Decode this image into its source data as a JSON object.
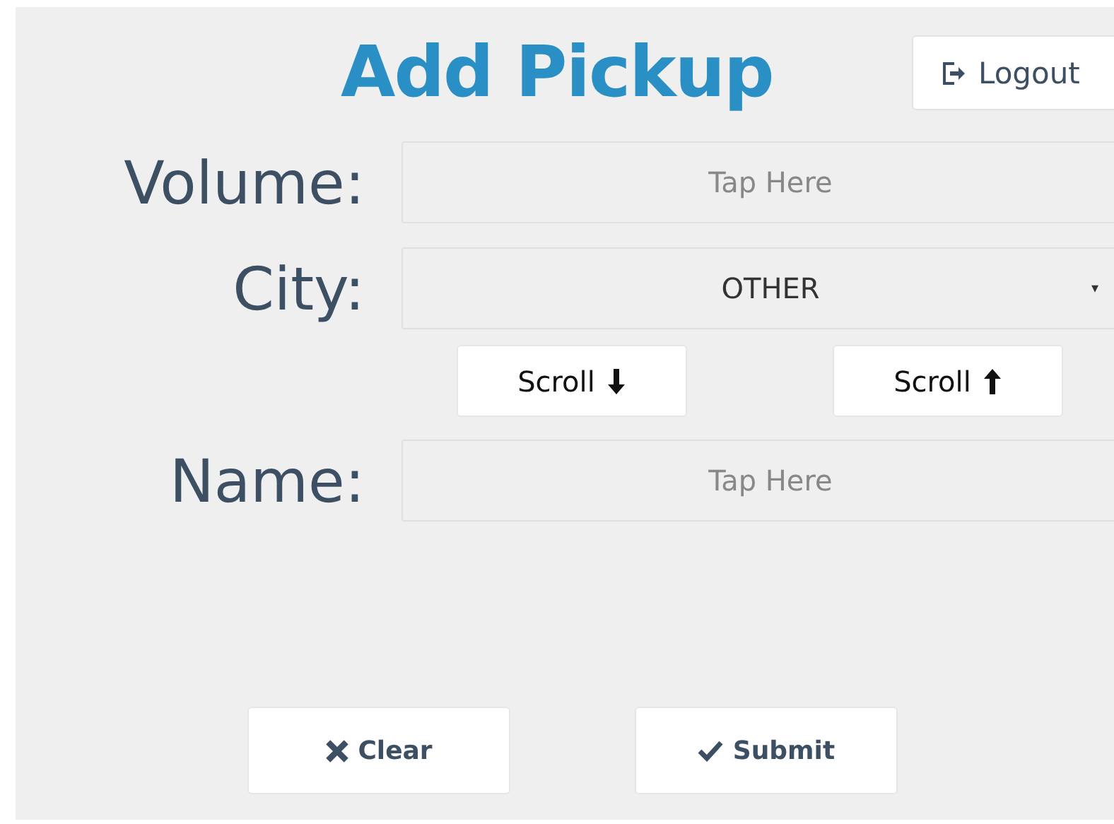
{
  "title": "Add Pickup",
  "logout": {
    "label": "Logout"
  },
  "fields": [
    {
      "kind": "input",
      "label": "Volume:",
      "placeholder": "Tap Here"
    },
    {
      "kind": "select",
      "label": "City:",
      "value": "OTHER",
      "caret": "▾"
    },
    {
      "kind": "scroll",
      "buttons": [
        {
          "label": "Scroll",
          "kind": "down"
        },
        {
          "label": "Scroll",
          "kind": "up"
        }
      ]
    },
    {
      "kind": "input",
      "label": "Name:",
      "placeholder": "Tap Here"
    }
  ],
  "actions": [
    {
      "kind": "clear",
      "label": "Clear"
    },
    {
      "kind": "submit",
      "label": "Submit"
    }
  ]
}
